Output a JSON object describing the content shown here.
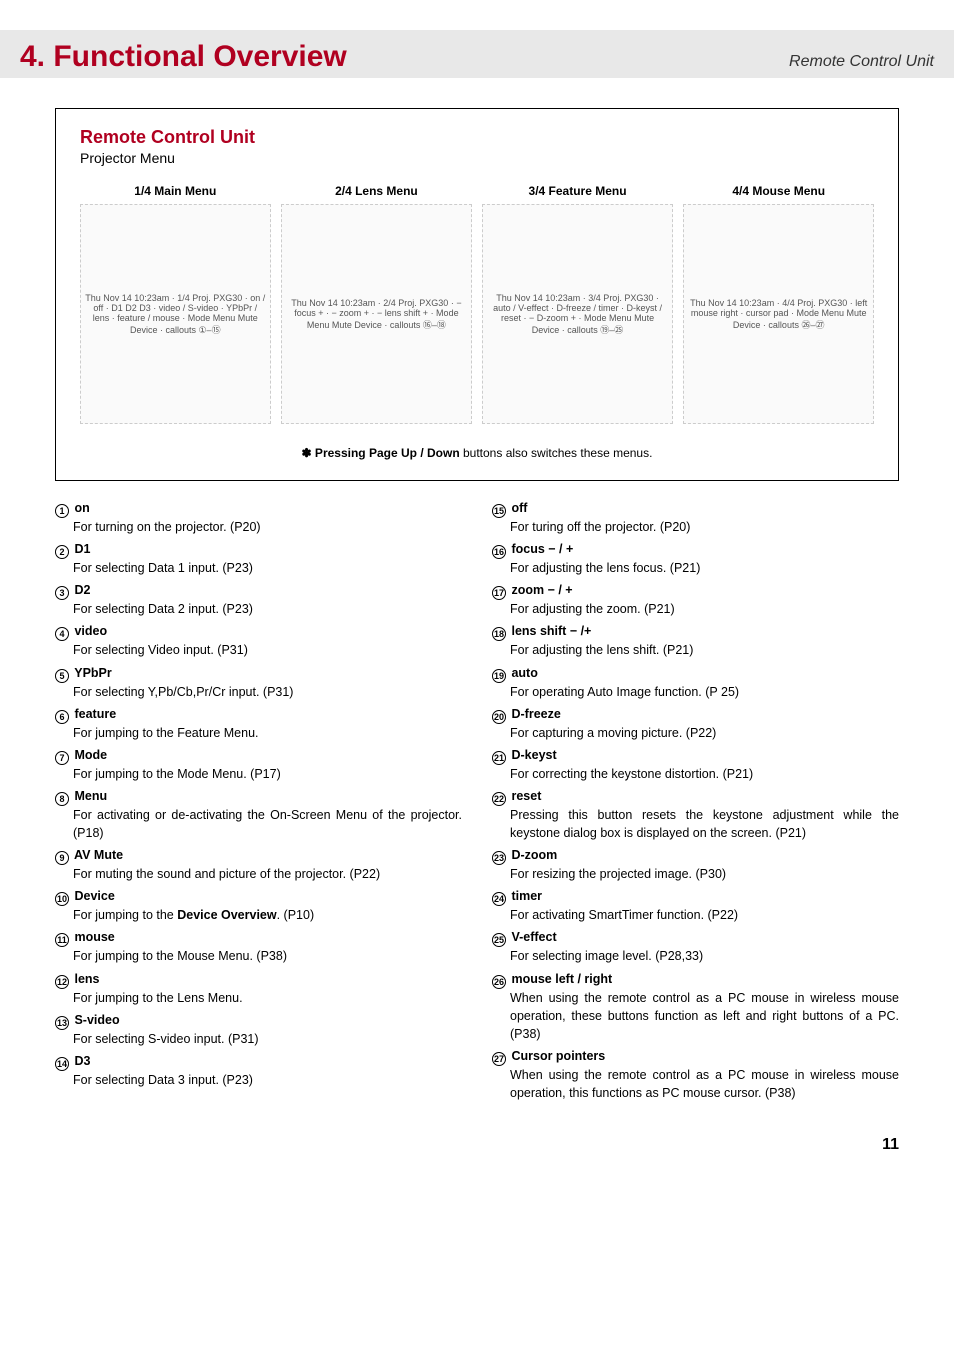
{
  "header": {
    "title": "4. Functional Overview",
    "subtitle": "Remote Control Unit"
  },
  "box": {
    "title": "Remote Control Unit",
    "subtitle": "Projector Menu",
    "menus": [
      {
        "heading": "1/4 Main Menu",
        "diagram_desc": "Thu Nov 14 10:23am · 1/4 Proj. PXG30 · on / off · D1 D2 D3 · video / S-video · YPbPr / lens · feature / mouse · Mode Menu Mute Device · callouts ①–⑮"
      },
      {
        "heading": "2/4 Lens Menu",
        "diagram_desc": "Thu Nov 14 10:23am · 2/4 Proj. PXG30 · − focus + · − zoom + · − lens shift + · Mode Menu Mute Device · callouts ⑯–⑱"
      },
      {
        "heading": "3/4 Feature Menu",
        "diagram_desc": "Thu Nov 14 10:23am · 3/4 Proj. PXG30 · auto / V-effect · D-freeze / timer · D-keyst / reset · − D-zoom + · Mode Menu Mute Device · callouts ⑲–㉕"
      },
      {
        "heading": "4/4 Mouse Menu",
        "diagram_desc": "Thu Nov 14 10:23am · 4/4 Proj. PXG30 · left mouse right · cursor pad · Mode Menu Mute Device · callouts ㉖–㉗"
      }
    ],
    "note_prefix": "✽ Pressing ",
    "note_bold": "Page Up / Down",
    "note_suffix": " buttons also switches these menus."
  },
  "left": [
    {
      "n": "1",
      "title": "on",
      "desc": "For turning on the projector. (P20)"
    },
    {
      "n": "2",
      "title": "D1",
      "desc": "For selecting Data 1 input. (P23)"
    },
    {
      "n": "3",
      "title": "D2",
      "desc": "For selecting Data 2 input. (P23)"
    },
    {
      "n": "4",
      "title": "video",
      "desc": "For selecting Video input. (P31)"
    },
    {
      "n": "5",
      "title": "YPbPr",
      "desc": "For selecting Y,Pb/Cb,Pr/Cr  input. (P31)"
    },
    {
      "n": "6",
      "title": "feature",
      "desc": "For jumping to the Feature Menu."
    },
    {
      "n": "7",
      "title": "Mode",
      "desc": "For jumping to the Mode Menu. (P17)"
    },
    {
      "n": "8",
      "title": "Menu",
      "desc": "For activating or de-activating the On-Screen Menu of the projector. (P18)"
    },
    {
      "n": "9",
      "title": "AV Mute",
      "desc": "For muting the sound and picture of the projector. (P22)"
    },
    {
      "n": "10",
      "title": "Device",
      "desc_pre": "For jumping to the ",
      "desc_bold": "Device Overview",
      "desc_post": ". (P10)"
    },
    {
      "n": "11",
      "title": "mouse",
      "desc": "For jumping to the Mouse Menu. (P38)"
    },
    {
      "n": "12",
      "title": "lens",
      "desc": "For jumping to the Lens Menu."
    },
    {
      "n": "13",
      "title": "S-video",
      "desc": "For selecting S-video input. (P31)"
    },
    {
      "n": "14",
      "title": "D3",
      "desc": "For selecting Data 3 input. (P23)"
    }
  ],
  "right": [
    {
      "n": "15",
      "title": "off",
      "desc": "For turing off the projector. (P20)"
    },
    {
      "n": "16",
      "title": "focus − / +",
      "desc": "For adjusting the lens focus. (P21)"
    },
    {
      "n": "17",
      "title": "zoom − / +",
      "desc": "For adjusting the zoom. (P21)"
    },
    {
      "n": "18",
      "title": "lens shift − /+",
      "desc": "For adjusting the lens shift. (P21)"
    },
    {
      "n": "19",
      "title": "auto",
      "desc": "For operating Auto Image function. (P 25)"
    },
    {
      "n": "20",
      "title": "D-freeze",
      "desc": "For capturing a moving picture. (P22)"
    },
    {
      "n": "21",
      "title": "D-keyst",
      "desc": "For correcting the keystone distortion. (P21)"
    },
    {
      "n": "22",
      "title": "reset",
      "desc": "Pressing this button resets the keystone adjustment while the keystone dialog box is displayed on the screen. (P21)"
    },
    {
      "n": "23",
      "title": "D-zoom",
      "desc": "For resizing the projected image. (P30)"
    },
    {
      "n": "24",
      "title": "timer",
      "desc": "For activating SmartTimer function. (P22)"
    },
    {
      "n": "25",
      "title": "V-effect",
      "desc": "For selecting image level. (P28,33)"
    },
    {
      "n": "26",
      "title": "mouse left / right",
      "desc": "When using the remote control as a PC mouse in wireless mouse operation, these buttons function as left and right buttons of a PC. (P38)"
    },
    {
      "n": "27",
      "title": "Cursor pointers",
      "desc": "When using the remote control as a PC mouse in wireless mouse operation, this functions as PC mouse cursor.  (P38)"
    }
  ],
  "page_number": "11"
}
